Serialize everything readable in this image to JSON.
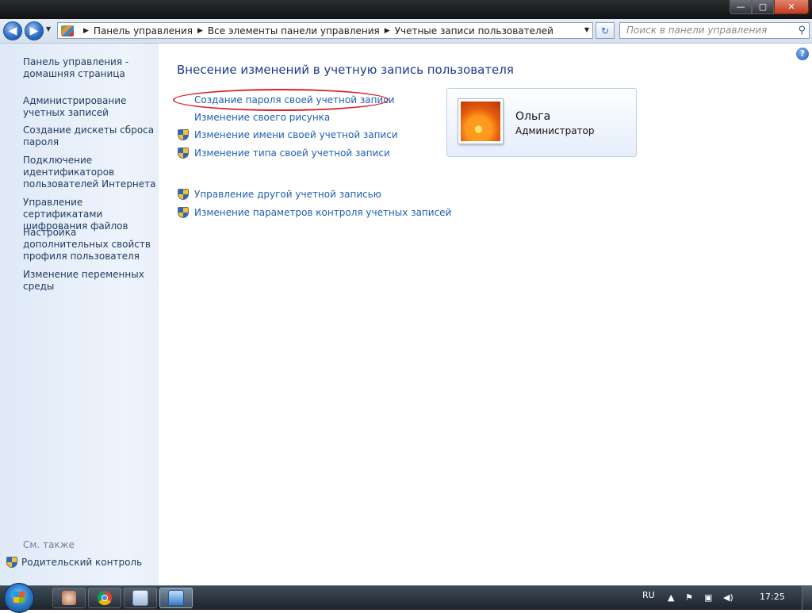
{
  "window": {
    "background_title": "…",
    "buttons": {
      "minimize": "—",
      "maximize": "▢",
      "close": "✕"
    }
  },
  "addressbar": {
    "crumbs": [
      "Панель управления",
      "Все элементы панели управления",
      "Учетные записи пользователей"
    ],
    "search_placeholder": "Поиск в панели управления"
  },
  "sidebar": {
    "home": "Панель управления - домашняя страница",
    "links": [
      "Администрирование учетных записей",
      "Создание дискеты сброса пароля",
      "Подключение идентификаторов пользователей Интернета",
      "Управление сертификатами шифрования файлов",
      "Настройка дополнительных свойств профиля пользователя",
      "Изменение переменных среды"
    ],
    "see_also": "См. также",
    "parental": "Родительский контроль"
  },
  "main": {
    "heading": "Внесение изменений в учетную запись пользователя",
    "tasks": [
      "Создание пароля своей учетной записи",
      "Изменение своего рисунка",
      "Изменение имени своей учетной записи",
      "Изменение типа своей учетной записи"
    ],
    "other_tasks": [
      "Управление другой учетной записью",
      "Изменение параметров контроля учетных записей"
    ],
    "help": "?"
  },
  "user": {
    "name": "Ольга",
    "role": "Администратор"
  },
  "taskbar": {
    "lang": "RU",
    "time": "17:25"
  },
  "colors": {
    "highlight": "#d9232a",
    "link": "#1f5fb3",
    "heading": "#1e3b8a"
  }
}
